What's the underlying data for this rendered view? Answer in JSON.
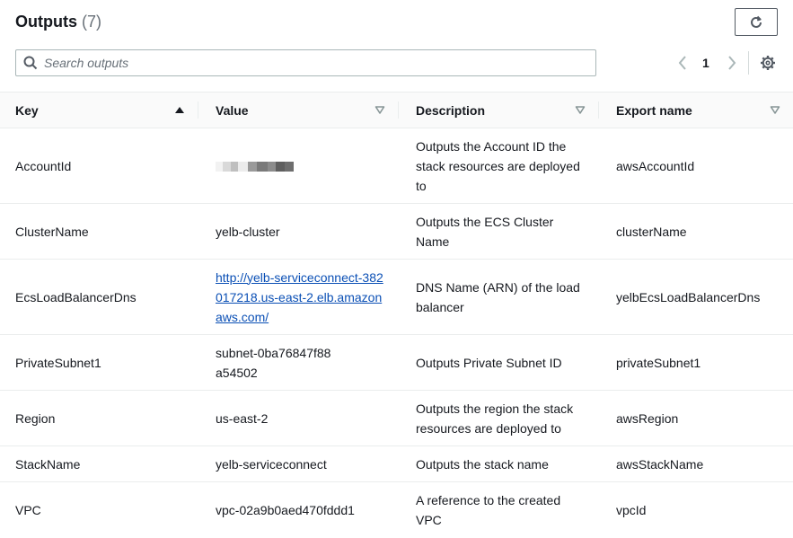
{
  "header": {
    "title": "Outputs",
    "count": "(7)"
  },
  "icons": {
    "refresh": "refresh-icon",
    "search": "search-icon",
    "prev": "chevron-left-icon",
    "next": "chevron-right-icon",
    "settings": "gear-icon",
    "sort_asc": "caret-up-icon",
    "sort": "caret-down-icon"
  },
  "search": {
    "placeholder": "Search outputs",
    "value": ""
  },
  "pagination": {
    "current": "1"
  },
  "table": {
    "columns": [
      "Key",
      "Value",
      "Description",
      "Export name"
    ],
    "rows": [
      {
        "key": "AccountId",
        "value": "",
        "description": "Outputs the Account ID the stack resources are deployed to",
        "export": "awsAccountId"
      },
      {
        "key": "ClusterName",
        "value": "yelb-cluster",
        "description": "Outputs the ECS Cluster Name",
        "export": "clusterName"
      },
      {
        "key": "EcsLoadBalancerDns",
        "value": "http://yelb-serviceconnect-382017218.us-east-2.elb.amazonaws.com/",
        "description": "DNS Name (ARN) of the load balancer",
        "export": "yelbEcsLoadBalancerDns"
      },
      {
        "key": "PrivateSubnet1",
        "value": "subnet-0ba76847f88a54502",
        "description": "Outputs Private Subnet ID",
        "export": "privateSubnet1"
      },
      {
        "key": "Region",
        "value": "us-east-2",
        "description": "Outputs the region the stack resources are deployed to",
        "export": "awsRegion"
      },
      {
        "key": "StackName",
        "value": "yelb-serviceconnect",
        "description": "Outputs the stack name",
        "export": "awsStackName"
      },
      {
        "key": "VPC",
        "value": "vpc-02a9b0aed470fddd1",
        "description": "A reference to the created VPC",
        "export": "vpcId"
      }
    ]
  },
  "colors": {
    "link": "#0a4fb5",
    "border": "#eaeded",
    "header_bg": "#fafafa"
  }
}
